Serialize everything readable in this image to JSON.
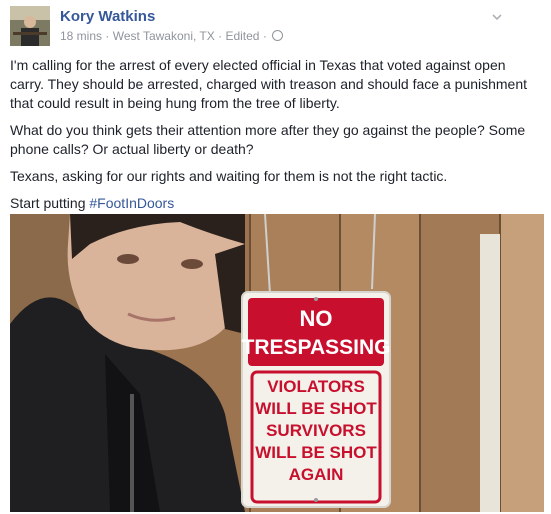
{
  "post": {
    "author": "Kory Watkins",
    "time": "18 mins",
    "location": "West Tawakoni, TX",
    "edited": "Edited",
    "separator": "·",
    "paragraphs": [
      "I'm calling for the arrest of every elected official in Texas that voted against open carry. They should be arrested, charged with treason and should face a punishment that could result in being hung from the tree of liberty.",
      "What do you think gets their attention more after they go against the people? Some phone calls? Or actual liberty or death?",
      "Texans, asking for our rights and waiting for them is not the right tactic."
    ],
    "last_line_prefix": "Start putting ",
    "hashtag": "#FootInDoors",
    "icons": {
      "privacy": "globe-icon",
      "menu": "chevron-down-icon"
    }
  },
  "sign": {
    "top_line1": "NO",
    "top_line2": "TRESPASSING",
    "bottom_lines": [
      "VIOLATORS",
      "WILL BE SHOT",
      "SURVIVORS",
      "WILL BE SHOT",
      "AGAIN"
    ]
  },
  "colors": {
    "author": "#365899",
    "hashtag": "#365899",
    "meta": "#90949c",
    "sign_red": "#c8102e"
  }
}
